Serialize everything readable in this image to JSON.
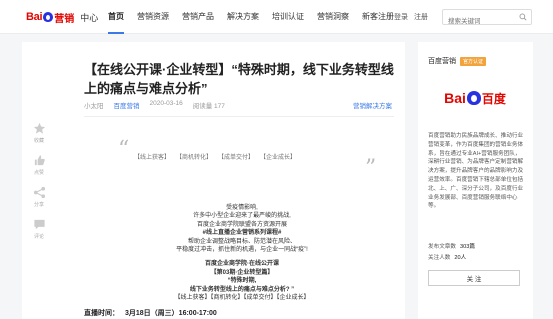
{
  "header": {
    "logo_bai": "Bai",
    "logo_text": "营销",
    "logo_sub": "中心",
    "nav": [
      "首页",
      "营销资源",
      "营销产品",
      "解决方案",
      "培训认证",
      "营销洞察",
      "新客注册"
    ],
    "login": "登录",
    "register": "注册",
    "search_placeholder": "搜索关键词"
  },
  "article": {
    "title": "【在线公开课·企业转型】“特殊时期，线下业务转型线上的痛点与难点分析”",
    "author": "小太阳",
    "source": "百度营销",
    "date": "2020-03-16",
    "read_count": "阅读量 177",
    "category": "营销解决方案",
    "tags": [
      "【线上获客】",
      "【商机转化】",
      "【成单交付】",
      "【企业成长】"
    ],
    "body": [
      "受疫情影响,",
      "许多中小型企业迎来了最严峻的挑战,",
      "百度企业商学院联盟各方资源开展",
      "#线上直播企业营销系列课程#",
      "帮助企业调整战略目标、防范潜在风险、",
      "平稳度过冲击，抓住新的机遇，与企业一同战“疫”!"
    ],
    "course_block": [
      "百度企业商学院·在线公开课",
      "【第03期·企业转型篇】",
      "“特殊时期,",
      "线下业务转型线上的痛点与难点分析? ”"
    ],
    "course_tags": "【线上获客】【商机转化】【成单交付】【企业成长】",
    "live_label": "直播时间：",
    "live_date": "3月18日（周三）16:00-17:00"
  },
  "actions": {
    "favorite": "收藏",
    "like": "点赞",
    "share": "分享",
    "comment": "评论"
  },
  "author_card": {
    "name": "百度营销",
    "badge": "官方认证",
    "logo_bai": "Bai",
    "logo_du": "百度",
    "description": "百度营销助力民族品牌成长、推动行业营销变革，作为百度集团的营销业务体系，旨在通过专业AI+营销服务团队，深耕行业营销、为品牌客户定制营销解决方案，提升品牌客户的品牌影响力及运营效率。百度营销下辖总部单位包括北、上、广、深分子公司，及百度行业业务发展部、百度营销服务联络中心等。",
    "articles_label": "发布文章数",
    "articles_count": "303篇",
    "followers_label": "关注人数",
    "followers_count": "20人",
    "follow_button": "关 注"
  }
}
